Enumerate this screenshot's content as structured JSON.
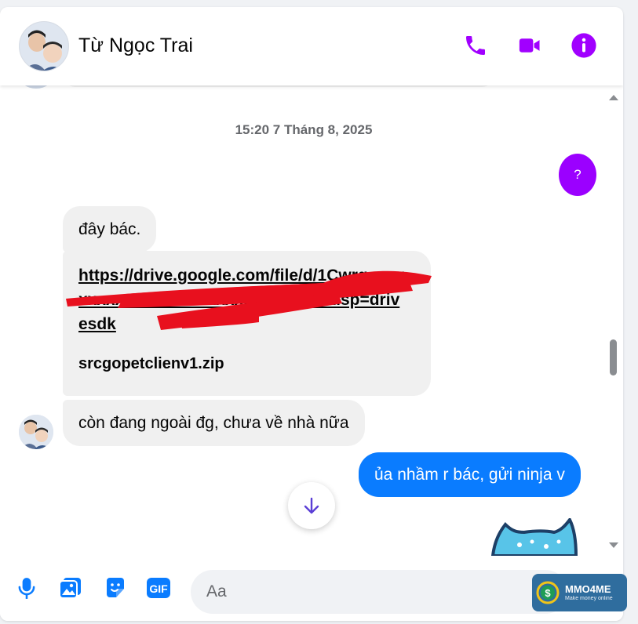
{
  "header": {
    "contact_name": "Từ Ngọc Trai",
    "icons": [
      "phone-icon",
      "video-icon",
      "info-icon"
    ]
  },
  "chat": {
    "timestamp": "15:20 7 Tháng 8, 2025",
    "messages": [
      {
        "from": "me",
        "text": "?"
      },
      {
        "from": "them",
        "text": "đây bác."
      },
      {
        "from": "them",
        "link": "https://drive.google.com/file/d/1Cwrg_xxxxxxxxxxxxxxxxxxxxxxxxx/view?usp=drivesdk",
        "attachment": "srcgopetclienv1.zip"
      },
      {
        "from": "them",
        "text": "còn đang ngoài đg, chưa về nhà nữa"
      },
      {
        "from": "me",
        "text": "ủa nhầm r bác, gửi ninja v"
      }
    ]
  },
  "composer": {
    "placeholder": "Aa",
    "tools": [
      "microphone-icon",
      "image-icon",
      "sticker-icon",
      "gif-icon"
    ]
  },
  "watermark": {
    "title": "MMO4ME",
    "subtitle": "Make money online"
  },
  "colors": {
    "accent": "#a100ff",
    "outgoing_bubble": "#0a7cff",
    "incoming_bubble": "#f0f0f0",
    "redaction": "#e8101e"
  }
}
